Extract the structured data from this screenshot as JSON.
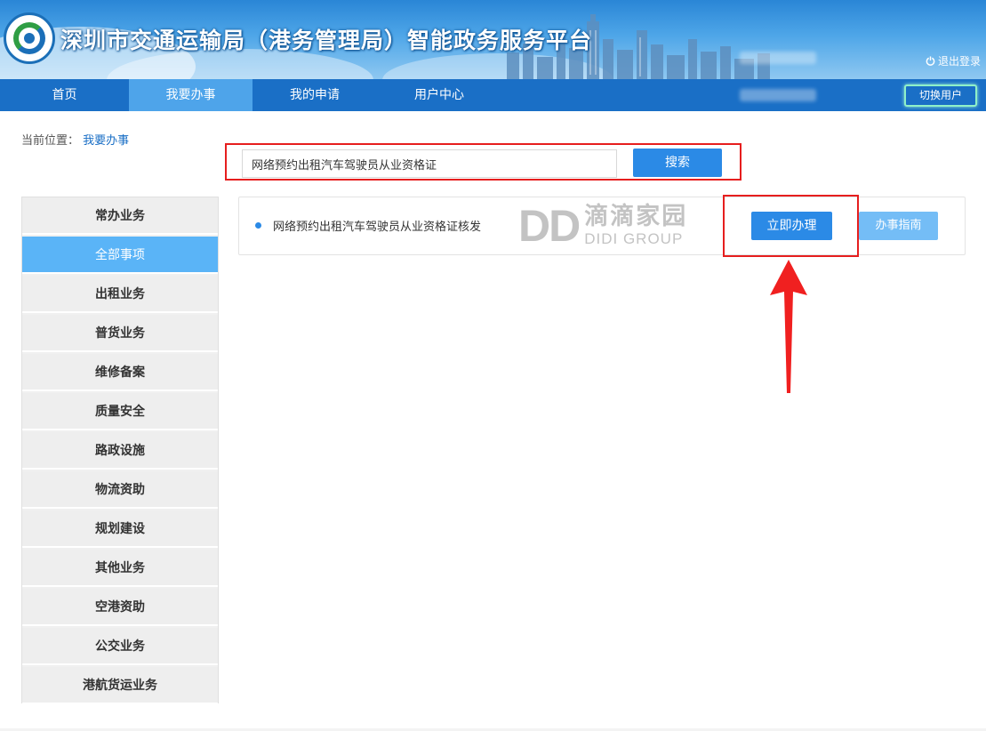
{
  "header": {
    "title": "深圳市交通运输局（港务管理局）智能政务服务平台",
    "logout_label": "退出登录"
  },
  "nav": {
    "items": [
      {
        "label": "首页"
      },
      {
        "label": "我要办事"
      },
      {
        "label": "我的申请"
      },
      {
        "label": "用户中心"
      }
    ],
    "active_index": 1,
    "switch_user_label": "切换用户"
  },
  "breadcrumb": {
    "prefix": "当前位置：",
    "current": "我要办事"
  },
  "search": {
    "value": "网络预约出租汽车驾驶员从业资格证",
    "button_label": "搜索"
  },
  "sidebar": {
    "items": [
      {
        "label": "常办业务"
      },
      {
        "label": "全部事项"
      },
      {
        "label": "出租业务"
      },
      {
        "label": "普货业务"
      },
      {
        "label": "维修备案"
      },
      {
        "label": "质量安全"
      },
      {
        "label": "路政设施"
      },
      {
        "label": "物流资助"
      },
      {
        "label": "规划建设"
      },
      {
        "label": "其他业务"
      },
      {
        "label": "空港资助"
      },
      {
        "label": "公交业务"
      },
      {
        "label": "港航货运业务"
      }
    ],
    "active_index": 1
  },
  "result": {
    "item_name": "网络预约出租汽车驾驶员从业资格证核发",
    "apply_label": "立即办理",
    "guide_label": "办事指南"
  },
  "watermark": {
    "logo": "DD",
    "cn": "滴滴家园",
    "en": "DIDI GROUP"
  },
  "colors": {
    "nav_bg": "#1a6fc6",
    "nav_active": "#4ea4ea",
    "primary_button": "#2b8ae6",
    "secondary_button": "#74bdf6",
    "sidebar_active": "#5ab4f7",
    "annotation_red": "#e61e1e"
  }
}
